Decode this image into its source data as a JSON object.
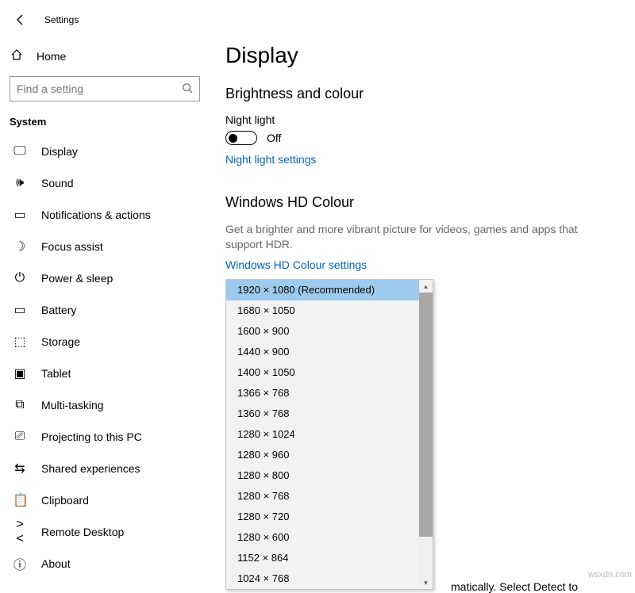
{
  "header": {
    "title": "Settings"
  },
  "sidebar": {
    "home": "Home",
    "search_placeholder": "Find a setting",
    "section": "System",
    "items": [
      {
        "label": "Display",
        "icon": "display-icon"
      },
      {
        "label": "Sound",
        "icon": "sound-icon"
      },
      {
        "label": "Notifications & actions",
        "icon": "notifications-icon"
      },
      {
        "label": "Focus assist",
        "icon": "focus-assist-icon"
      },
      {
        "label": "Power & sleep",
        "icon": "power-icon"
      },
      {
        "label": "Battery",
        "icon": "battery-icon"
      },
      {
        "label": "Storage",
        "icon": "storage-icon"
      },
      {
        "label": "Tablet",
        "icon": "tablet-icon"
      },
      {
        "label": "Multi-tasking",
        "icon": "multitasking-icon"
      },
      {
        "label": "Projecting to this PC",
        "icon": "projecting-icon"
      },
      {
        "label": "Shared experiences",
        "icon": "shared-icon"
      },
      {
        "label": "Clipboard",
        "icon": "clipboard-icon"
      },
      {
        "label": "Remote Desktop",
        "icon": "remote-desktop-icon"
      },
      {
        "label": "About",
        "icon": "about-icon"
      }
    ]
  },
  "main": {
    "title": "Display",
    "brightness_header": "Brightness and colour",
    "night_light_label": "Night light",
    "night_light_state": "Off",
    "night_light_link": "Night light settings",
    "hdcolour_header": "Windows HD Colour",
    "hdcolour_desc": "Get a brighter and more vibrant picture for videos, games and apps that support HDR.",
    "hdcolour_link": "Windows HD Colour settings",
    "detect_fragment": "matically. Select Detect to"
  },
  "resolution_dropdown": {
    "selected_index": 0,
    "options": [
      "1920 × 1080 (Recommended)",
      "1680 × 1050",
      "1600 × 900",
      "1440 × 900",
      "1400 × 1050",
      "1366 × 768",
      "1360 × 768",
      "1280 × 1024",
      "1280 × 960",
      "1280 × 800",
      "1280 × 768",
      "1280 × 720",
      "1280 × 600",
      "1152 × 864",
      "1024 × 768"
    ]
  },
  "watermark": "wsxdn.com",
  "icon_glyphs": {
    "display-icon": "🖵",
    "sound-icon": "🕪",
    "notifications-icon": "▭",
    "focus-assist-icon": "☽",
    "power-icon": "⏻",
    "battery-icon": "▭",
    "storage-icon": "⬚",
    "tablet-icon": "▣",
    "multitasking-icon": "⧉",
    "projecting-icon": "⎚",
    "shared-icon": "⇆",
    "clipboard-icon": "📋",
    "remote-desktop-icon": "><",
    "about-icon": "ⓘ"
  }
}
